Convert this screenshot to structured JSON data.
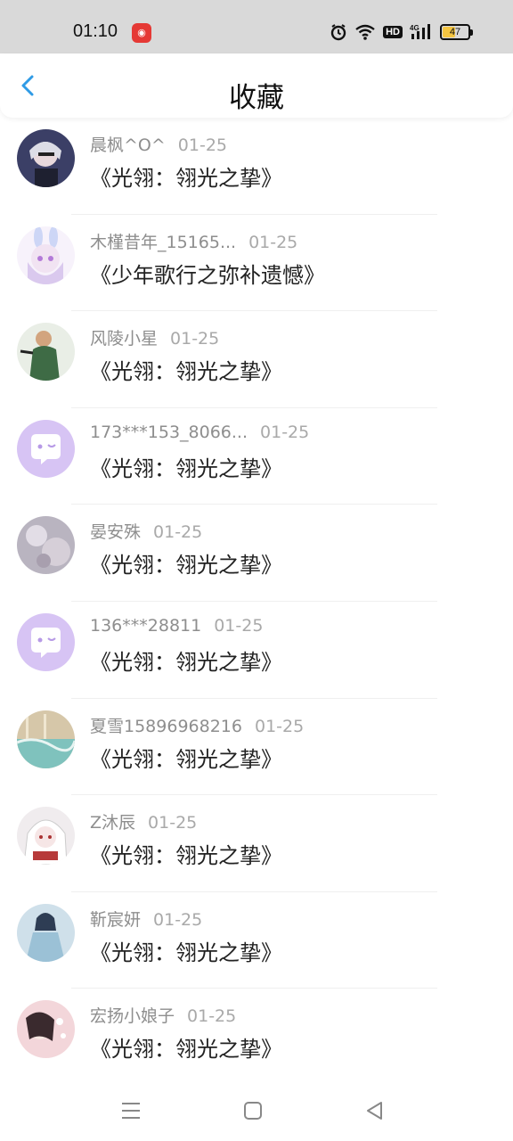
{
  "status_bar": {
    "time": "01:10",
    "battery": "47",
    "hd_label": "HD",
    "network_label": "4G"
  },
  "header": {
    "title": "收藏"
  },
  "favorites": [
    {
      "user": "晨枫^O^",
      "date": "01-25",
      "book": "《光翎：翎光之挚》",
      "avatar_style": "anime-dark"
    },
    {
      "user": "木槿昔年_15165...",
      "date": "01-25",
      "book": "《少年歌行之弥补遗憾》",
      "avatar_style": "anime-bunny"
    },
    {
      "user": "风陵小星",
      "date": "01-25",
      "book": "《光翎：翎光之挚》",
      "avatar_style": "photo-green"
    },
    {
      "user": "173***153_8066...",
      "date": "01-25",
      "book": "《光翎：翎光之挚》",
      "avatar_style": "default-chat"
    },
    {
      "user": "晏安殊",
      "date": "01-25",
      "book": "《光翎：翎光之挚》",
      "avatar_style": "photo-grey"
    },
    {
      "user": "136***28811",
      "date": "01-25",
      "book": "《光翎：翎光之挚》",
      "avatar_style": "default-chat"
    },
    {
      "user": "夏雪15896968216",
      "date": "01-25",
      "book": "《光翎：翎光之挚》",
      "avatar_style": "photo-teal"
    },
    {
      "user": "Z沐辰",
      "date": "01-25",
      "book": "《光翎：翎光之挚》",
      "avatar_style": "anime-white"
    },
    {
      "user": "靳宸妍",
      "date": "01-25",
      "book": "《光翎：翎光之挚》",
      "avatar_style": "anime-blue"
    },
    {
      "user": "宏扬小娘子",
      "date": "01-25",
      "book": "《光翎：翎光之挚》",
      "avatar_style": "photo-pink"
    }
  ],
  "nav_bar": {
    "icons": [
      "menu-icon",
      "home-square-icon",
      "back-triangle-icon"
    ]
  },
  "colors": {
    "accent": "#2f9be6",
    "default_avatar": "#d7c4f4"
  }
}
